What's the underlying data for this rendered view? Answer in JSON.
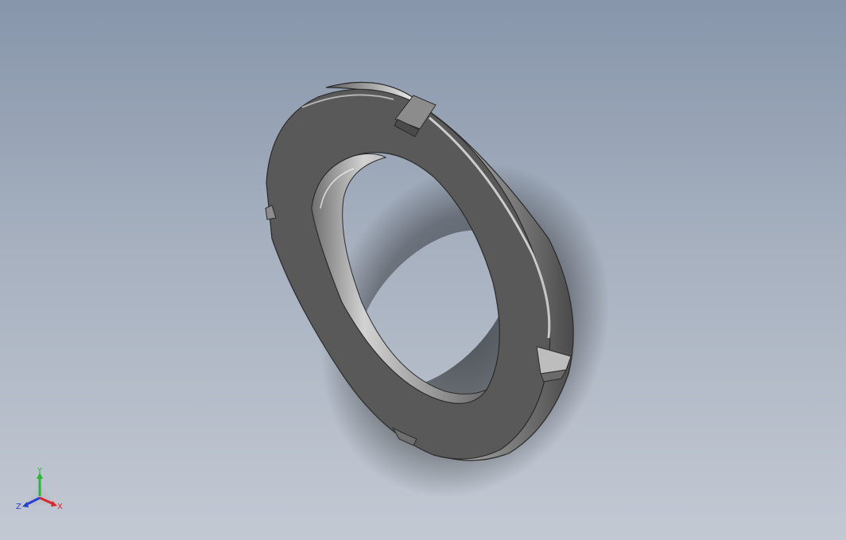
{
  "viewport": {
    "model": "locknut-ring",
    "background_top": "#8796ab",
    "background_bottom": "#c3c9d3"
  },
  "triad": {
    "x_label": "X",
    "y_label": "Y",
    "z_label": "Z",
    "x_color": "#d8272a",
    "y_color": "#2fb43a",
    "z_color": "#2b3fd1"
  }
}
